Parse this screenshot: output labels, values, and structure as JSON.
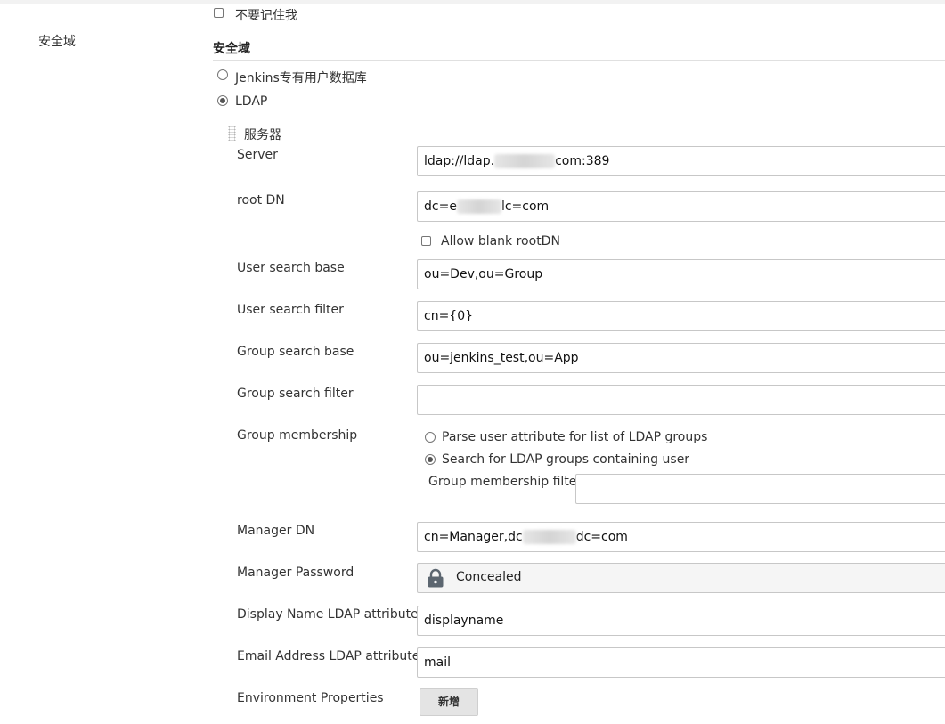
{
  "remember_me": {
    "label": "不要记住我",
    "checked": false
  },
  "sidebar": {
    "security_realm_label": "安全域"
  },
  "section": {
    "title": "安全域"
  },
  "realm_options": [
    {
      "label": "Jenkins专有用户数据库",
      "selected": false
    },
    {
      "label": "LDAP",
      "selected": true
    }
  ],
  "servers": {
    "heading": "服务器"
  },
  "form": {
    "server": {
      "label": "Server",
      "value_prefix": "ldap://ldap.",
      "value_suffix": "com:389"
    },
    "root_dn": {
      "label": "root DN",
      "value_prefix": "dc=e",
      "value_suffix": "lc=com"
    },
    "allow_blank_root_dn": {
      "label": "Allow blank rootDN",
      "checked": false
    },
    "user_search_base": {
      "label": "User search base",
      "value": "ou=Dev,ou=Group"
    },
    "user_search_filter": {
      "label": "User search filter",
      "value": "cn={0}"
    },
    "group_search_base": {
      "label": "Group search base",
      "value": "ou=jenkins_test,ou=App"
    },
    "group_search_filter": {
      "label": "Group search filter",
      "value": ""
    },
    "group_membership": {
      "label": "Group membership",
      "options": [
        {
          "label": "Parse user attribute for list of LDAP groups",
          "selected": false
        },
        {
          "label": "Search for LDAP groups containing user",
          "selected": true
        }
      ],
      "filter_label": "Group membership filter",
      "filter_value": ""
    },
    "manager_dn": {
      "label": "Manager DN",
      "value_prefix": "cn=Manager,dc",
      "value_suffix": "dc=com"
    },
    "manager_password": {
      "label": "Manager Password",
      "value": "Concealed"
    },
    "display_name_attr": {
      "label": "Display Name LDAP attribute",
      "value": "displayname"
    },
    "email_attr": {
      "label": "Email Address LDAP attribute",
      "value": "mail"
    },
    "env_properties": {
      "label": "Environment Properties",
      "add_button": "新增"
    }
  }
}
